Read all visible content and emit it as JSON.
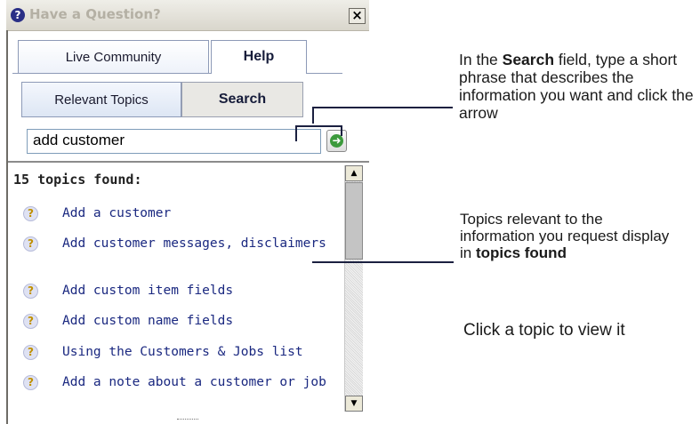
{
  "window": {
    "title": "Have a Question?",
    "title_icon": "question-mark-icon",
    "close_label": "×"
  },
  "tabs": [
    {
      "label": "Live Community",
      "active": false
    },
    {
      "label": "Help",
      "active": true
    }
  ],
  "subtabs": [
    {
      "label": "Relevant Topics",
      "active": false
    },
    {
      "label": "Search",
      "active": true
    }
  ],
  "search": {
    "value": "add customer",
    "go_icon": "green-arrow-icon"
  },
  "results": {
    "count_text": "15 topics found:",
    "topics": [
      {
        "label": "Add a customer"
      },
      {
        "label": "Add customer messages, disclaimers"
      },
      {
        "label": "Add custom item fields"
      },
      {
        "label": "Add custom name fields"
      },
      {
        "label": "Using the Customers & Jobs list"
      },
      {
        "label": "Add a note about a customer or job"
      }
    ]
  },
  "annotations": {
    "search_note": {
      "pre": "In the ",
      "bold": "Search",
      "post": " field, type a short phrase that describes the information you want and click the arrow"
    },
    "topics_note": {
      "pre": "Topics relevant to the information you request display in ",
      "bold": "topics found",
      "post": ""
    },
    "click_note": "Click a topic to view it"
  },
  "colors": {
    "link": "#1a2880",
    "callout": "#1b2040",
    "go_arrow": "#3c9a3c"
  }
}
